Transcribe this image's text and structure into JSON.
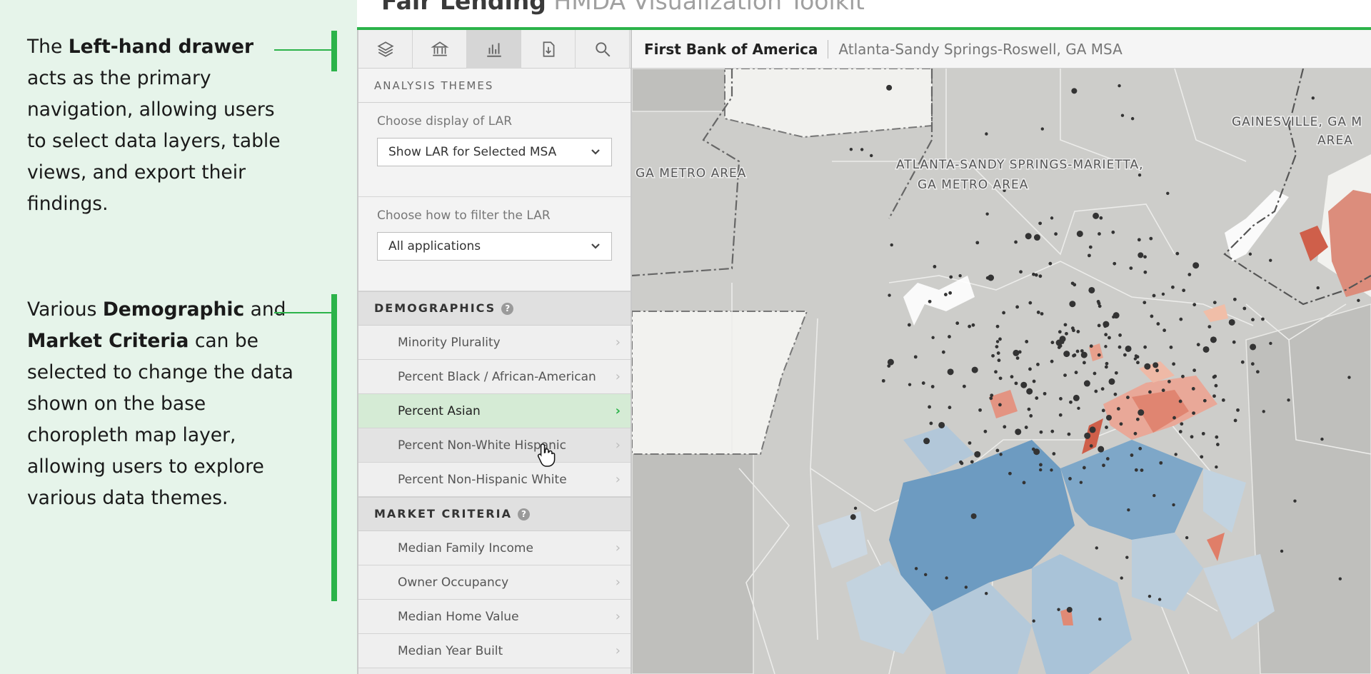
{
  "annotations": [
    {
      "pre": "The ",
      "bold1": "Left-hand drawer",
      "mid": " acts as the primary navigation, allowing users to select data layers, table views, and export their findings.",
      "bold2": "",
      "post": ""
    },
    {
      "pre": "Various ",
      "bold1": "Demographic",
      "mid": " and ",
      "bold2": "Market Criteria",
      "post": " can be selected to change the data shown on the base choropleth map layer, allowing users to explore various data themes."
    }
  ],
  "header": {
    "title_bold": "Fair Lending",
    "title_light": "HMDA Visualization Toolkit"
  },
  "toolbar": {
    "icons": [
      "layers-icon",
      "bank-icon",
      "chart-icon",
      "download-icon",
      "search-icon"
    ],
    "active": "chart-icon"
  },
  "sidebar": {
    "themes_heading": "ANALYSIS THEMES",
    "lar_display": {
      "label": "Choose display of LAR",
      "value": "Show LAR for Selected MSA"
    },
    "lar_filter": {
      "label": "Choose how to filter the LAR",
      "value": "All applications"
    },
    "demographics": {
      "heading": "DEMOGRAPHICS",
      "help": "?",
      "items": [
        {
          "label": "Minority Plurality"
        },
        {
          "label": "Percent Black / African-American"
        },
        {
          "label": "Percent Asian",
          "active": true
        },
        {
          "label": "Percent Non-White Hispanic",
          "hover": true
        },
        {
          "label": "Percent Non-Hispanic White"
        }
      ]
    },
    "market_criteria": {
      "heading": "MARKET CRITERIA",
      "help": "?",
      "items": [
        {
          "label": "Median Family Income"
        },
        {
          "label": "Owner Occupancy"
        },
        {
          "label": "Median Home Value"
        },
        {
          "label": "Median Year Built"
        }
      ]
    }
  },
  "map": {
    "bank": "First Bank of America",
    "msa": "Atlanta-Sandy Springs-Roswell, GA MSA",
    "labels": [
      {
        "text": "GA METRO AREA"
      },
      {
        "text": "ATLANTA-SANDY SPRINGS-MARIETTA,"
      },
      {
        "text": "GA METRO AREA"
      },
      {
        "text": "GAINESVILLE, GA M"
      },
      {
        "text": "AREA"
      }
    ]
  },
  "colors": {
    "accent": "#2cb34a",
    "blue_choropleth": "#5c8db5",
    "red_choropleth": "#d9664e",
    "dot": "#333333"
  }
}
